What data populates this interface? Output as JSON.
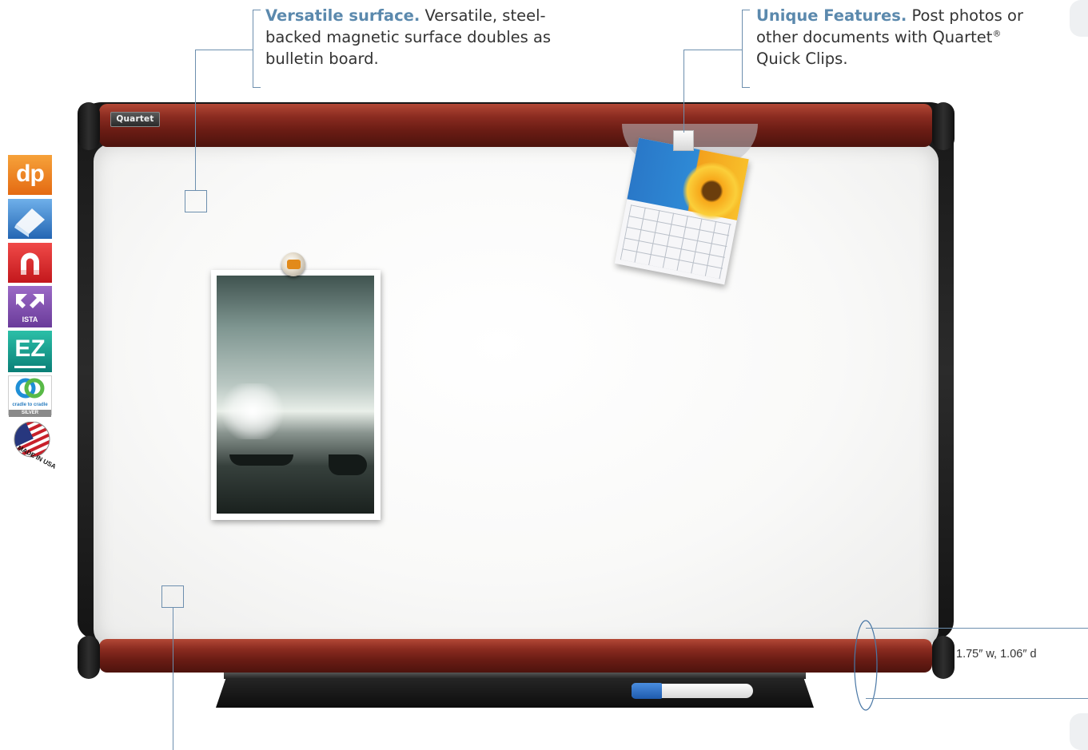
{
  "callouts": {
    "surface": {
      "title": "Versatile surface.",
      "line1": "Versatile, steel-",
      "line2": "backed magnetic surface doubles as",
      "line3": "bulletin board."
    },
    "features": {
      "title": "Unique Features.",
      "line1": "Post photos or",
      "line2_prefix": "other documents with Quartet",
      "registered": "®",
      "line3": "Quick Clips."
    }
  },
  "board": {
    "logo": "Quartet"
  },
  "dimension": "1.75″ w, 1.06″ d",
  "badges": [
    {
      "label": "dp",
      "icon": "dp-badge-icon"
    },
    {
      "label": "",
      "icon": "eraser-icon"
    },
    {
      "label": "",
      "icon": "magnet-icon"
    },
    {
      "label": "ISTA",
      "icon": "ista-arrows-icon"
    },
    {
      "label": "EZ",
      "icon": "ez-badge-icon"
    },
    {
      "label": "cradle to cradle",
      "sublabel": "SILVER",
      "icon": "cradle-to-cradle-icon"
    },
    {
      "label": "MADE IN USA",
      "icon": "usa-flag-icon"
    }
  ],
  "colors": {
    "accent": "#5b89ad",
    "leader_line": "#6d8fae",
    "frame_wood": "#7a2419"
  }
}
